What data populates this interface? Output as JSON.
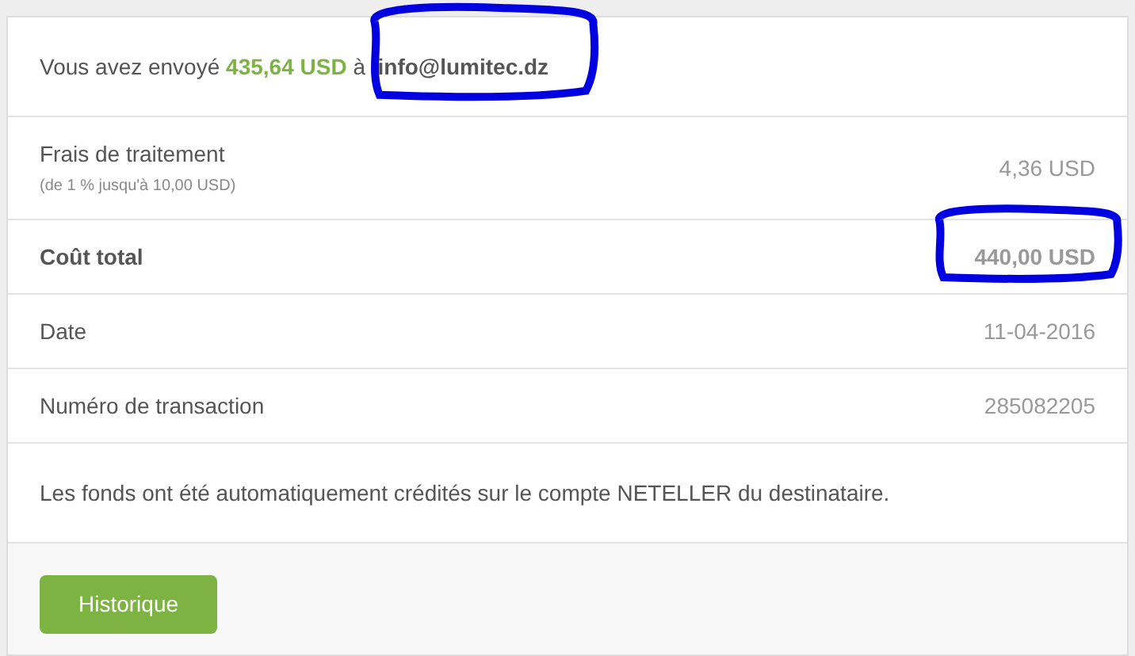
{
  "summary": {
    "prefix": "Vous avez envoyé",
    "amount": "435,64 USD",
    "connector": "à",
    "recipient": "info@lumitec.dz",
    "recipient_highlighted": true
  },
  "rows": [
    {
      "label": "Frais de traitement",
      "note": "(de 1 % jusqu'à 10,00 USD)",
      "value": "4,36 USD",
      "bold": false,
      "highlighted": false
    },
    {
      "label": "Coût total",
      "value": "440,00 USD",
      "bold": true,
      "highlighted": true
    },
    {
      "label": "Date",
      "value": "11-04-2016",
      "bold": false,
      "highlighted": false
    },
    {
      "label": "Numéro de transaction",
      "value": "285082205",
      "bold": false,
      "highlighted": false
    }
  ],
  "message": "Les fonds ont été automatiquement crédités sur le compte NETELLER du destinataire.",
  "buttons": [
    "Historique"
  ]
}
